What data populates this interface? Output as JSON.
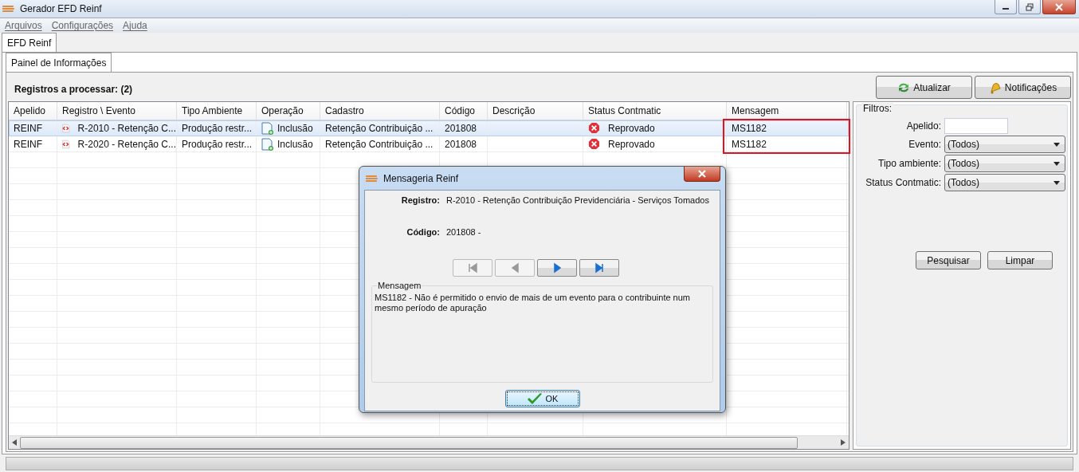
{
  "window": {
    "title": "Gerador EFD Reinf"
  },
  "menu": [
    "Arquivos",
    "Configurações",
    "Ajuda"
  ],
  "tabs": [
    {
      "label": "EFD Reinf",
      "selected": true
    }
  ],
  "subtabs": [
    {
      "label": "Painel de Informações",
      "selected": true
    }
  ],
  "summary": "Registros a processar: (2)",
  "toolbar": [
    {
      "kind": "refresh",
      "label": "Atualizar"
    },
    {
      "kind": "bell",
      "label": "Notificações"
    }
  ],
  "table": {
    "columns": [
      "Apelido",
      "Registro \\ Evento",
      "Tipo Ambiente",
      "Operação",
      "Cadastro",
      "Código",
      "Descrição",
      "Status Contmatic",
      "Mensagem"
    ],
    "message_highlighted": true,
    "rows": [
      {
        "selected": true,
        "apelido": "REINF",
        "registro": "R-2010 - Retenção C...",
        "tipo_ambiente": "Produção restr...",
        "operacao": "Inclusão",
        "cadastro": "Retenção Contribuição ...",
        "codigo": "201808",
        "status": "Reprovado",
        "status_error": true,
        "mensagem": "MS1182"
      },
      {
        "selected": false,
        "apelido": "REINF",
        "registro": "R-2020 - Retenção C...",
        "tipo_ambiente": "Produção restr...",
        "operacao": "Inclusão",
        "cadastro": "Retenção Contribuição ...",
        "codigo": "201808",
        "status": "Reprovado",
        "status_error": true,
        "mensagem": "MS1182"
      }
    ]
  },
  "filters": {
    "title": "Filtros:",
    "fields": [
      {
        "kind": "text",
        "label": "Apelido:"
      },
      {
        "kind": "select",
        "label": "Evento:",
        "value": "(Todos)"
      },
      {
        "kind": "select",
        "label": "Tipo ambiente:",
        "value": "(Todos)"
      },
      {
        "kind": "select",
        "label": "Status Contmatic:",
        "value": "(Todos)"
      }
    ],
    "buttons": [
      "Pesquisar",
      "Limpar"
    ]
  },
  "dialog": {
    "title": "Mensageria Reinf",
    "fields": [
      {
        "label": "Registro:",
        "value": "R-2010 - Retenção Contribuição Previdenciária - Serviços Tomados"
      },
      {
        "label": "Código:",
        "value": "201808 -"
      }
    ],
    "nav": [
      {
        "kind": "first",
        "disabled": true
      },
      {
        "kind": "prev",
        "disabled": true
      },
      {
        "kind": "next",
        "disabled": false
      },
      {
        "kind": "last",
        "disabled": false
      }
    ],
    "message_title": "Mensagem",
    "message": "MS1182 - Não é permitido o envio de mais de um evento para o contribuinte num mesmo período de apuração",
    "ok": "OK"
  }
}
